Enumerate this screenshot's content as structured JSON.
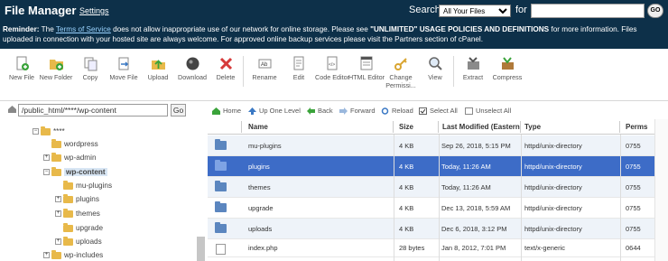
{
  "header": {
    "title": "File Manager",
    "settings": "Settings",
    "search_label": "Search",
    "search_scope": "All Your Files",
    "for_label": "for",
    "go_label": "GO"
  },
  "reminder": {
    "prefix": "Reminder:",
    "text1": "The",
    "tos_link": "Terms of Service",
    "text2": "does not allow inappropriate use of our network for online storage. Please see",
    "bold_text": "\"UNLIMITED\" USAGE POLICIES AND DEFINITIONS",
    "text3": "for more information. Files uploaded in connection with your hosted site are always welcome. For approved online backup services please visit the Partners section of cPanel."
  },
  "toolbar": {
    "new_file": "New File",
    "new_folder": "New Folder",
    "copy": "Copy",
    "move_file": "Move File",
    "upload": "Upload",
    "download": "Download",
    "delete": "Delete",
    "rename": "Rename",
    "edit": "Edit",
    "code_editor": "Code Editor",
    "html_editor": "HTML Editor",
    "change_permissions": "Change Permissi...",
    "view": "View",
    "extract": "Extract",
    "compress": "Compress"
  },
  "pathbar": {
    "path": "/public_html/****/wp-content",
    "go": "Go"
  },
  "tree": {
    "root": "****",
    "items": [
      "wordpress",
      "wp-admin",
      "wp-content",
      "mu-plugins",
      "plugins",
      "themes",
      "upgrade",
      "uploads",
      "wp-includes"
    ]
  },
  "nav": {
    "home": "Home",
    "up_one_level": "Up One Level",
    "back": "Back",
    "forward": "Forward",
    "reload": "Reload",
    "select_all": "Select All",
    "unselect_all": "Unselect All"
  },
  "table": {
    "columns": [
      "Name",
      "Size",
      "Last Modified (Eastern E",
      "Type",
      "Perms"
    ],
    "rows": [
      {
        "name": "mu-plugins",
        "size": "4 KB",
        "modified": "Sep 26, 2018, 5:15 PM",
        "type": "httpd/unix-directory",
        "perms": "0755"
      },
      {
        "name": "plugins",
        "size": "4 KB",
        "modified": "Today, 11:26 AM",
        "type": "httpd/unix-directory",
        "perms": "0755"
      },
      {
        "name": "themes",
        "size": "4 KB",
        "modified": "Today, 11:26 AM",
        "type": "httpd/unix-directory",
        "perms": "0755"
      },
      {
        "name": "upgrade",
        "size": "4 KB",
        "modified": "Dec 13, 2018, 5:59 AM",
        "type": "httpd/unix-directory",
        "perms": "0755"
      },
      {
        "name": "uploads",
        "size": "4 KB",
        "modified": "Dec 6, 2018, 3:12 PM",
        "type": "httpd/unix-directory",
        "perms": "0755"
      },
      {
        "name": "index.php",
        "size": "28 bytes",
        "modified": "Jan 8, 2012, 7:01 PM",
        "type": "text/x-generic",
        "perms": "0644"
      }
    ]
  },
  "colors": {
    "header_bg": "#0d3049",
    "selected_row": "#3d6cc7",
    "alt_row": "#eef3f9"
  }
}
